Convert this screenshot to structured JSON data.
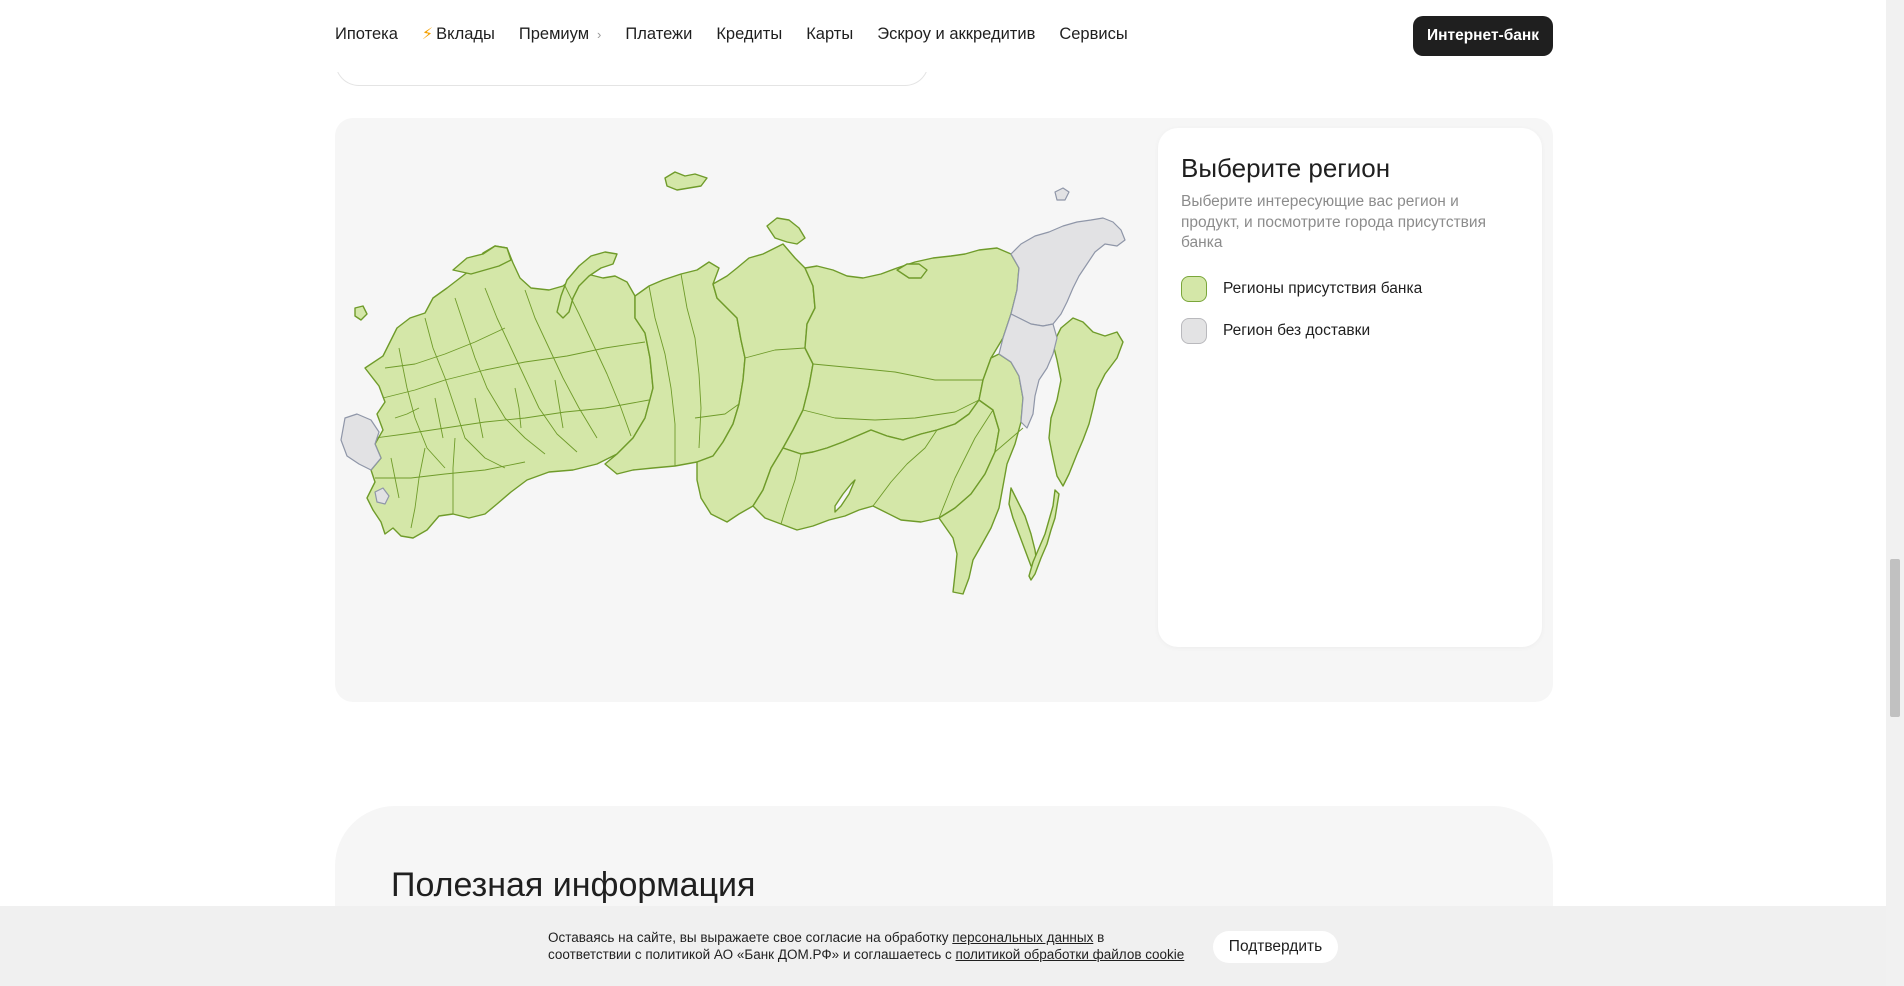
{
  "nav": {
    "items": [
      {
        "label": "Ипотека"
      },
      {
        "label": "Вклады"
      },
      {
        "label": "Премиум"
      },
      {
        "label": "Платежи"
      },
      {
        "label": "Кредиты"
      },
      {
        "label": "Карты"
      },
      {
        "label": "Эскроу и аккредитив"
      },
      {
        "label": "Сервисы"
      }
    ],
    "bank_button": "Интернет-банк"
  },
  "region_panel": {
    "title": "Выберите регион",
    "description": "Выберите интересующие вас регион и продукт, и посмотрите города присутствия банка",
    "legend": [
      {
        "label": "Регионы присутствия банка",
        "color": "#d4e7a8",
        "border": "#7aa63a"
      },
      {
        "label": "Регион без доставки",
        "color": "#e3e3e4",
        "border": "#b9b9bd"
      }
    ]
  },
  "map_colors": {
    "presence": "#d4e7a8",
    "presence_stroke": "#6f9b2a",
    "no_delivery": "#e2e2e4",
    "no_delivery_stroke": "#8f96a8"
  },
  "info": {
    "title": "Полезная информация"
  },
  "cookie": {
    "text_1": "Оставаясь на сайте, вы выражаете свое согласие на обработку ",
    "link_1": "персональных данных",
    "text_2": " в соответствии с политикой АО «Банк ДОМ.РФ» и соглашаетесь с ",
    "link_2": "политикой обработки файлов cookie",
    "confirm": "Подтвердить"
  }
}
